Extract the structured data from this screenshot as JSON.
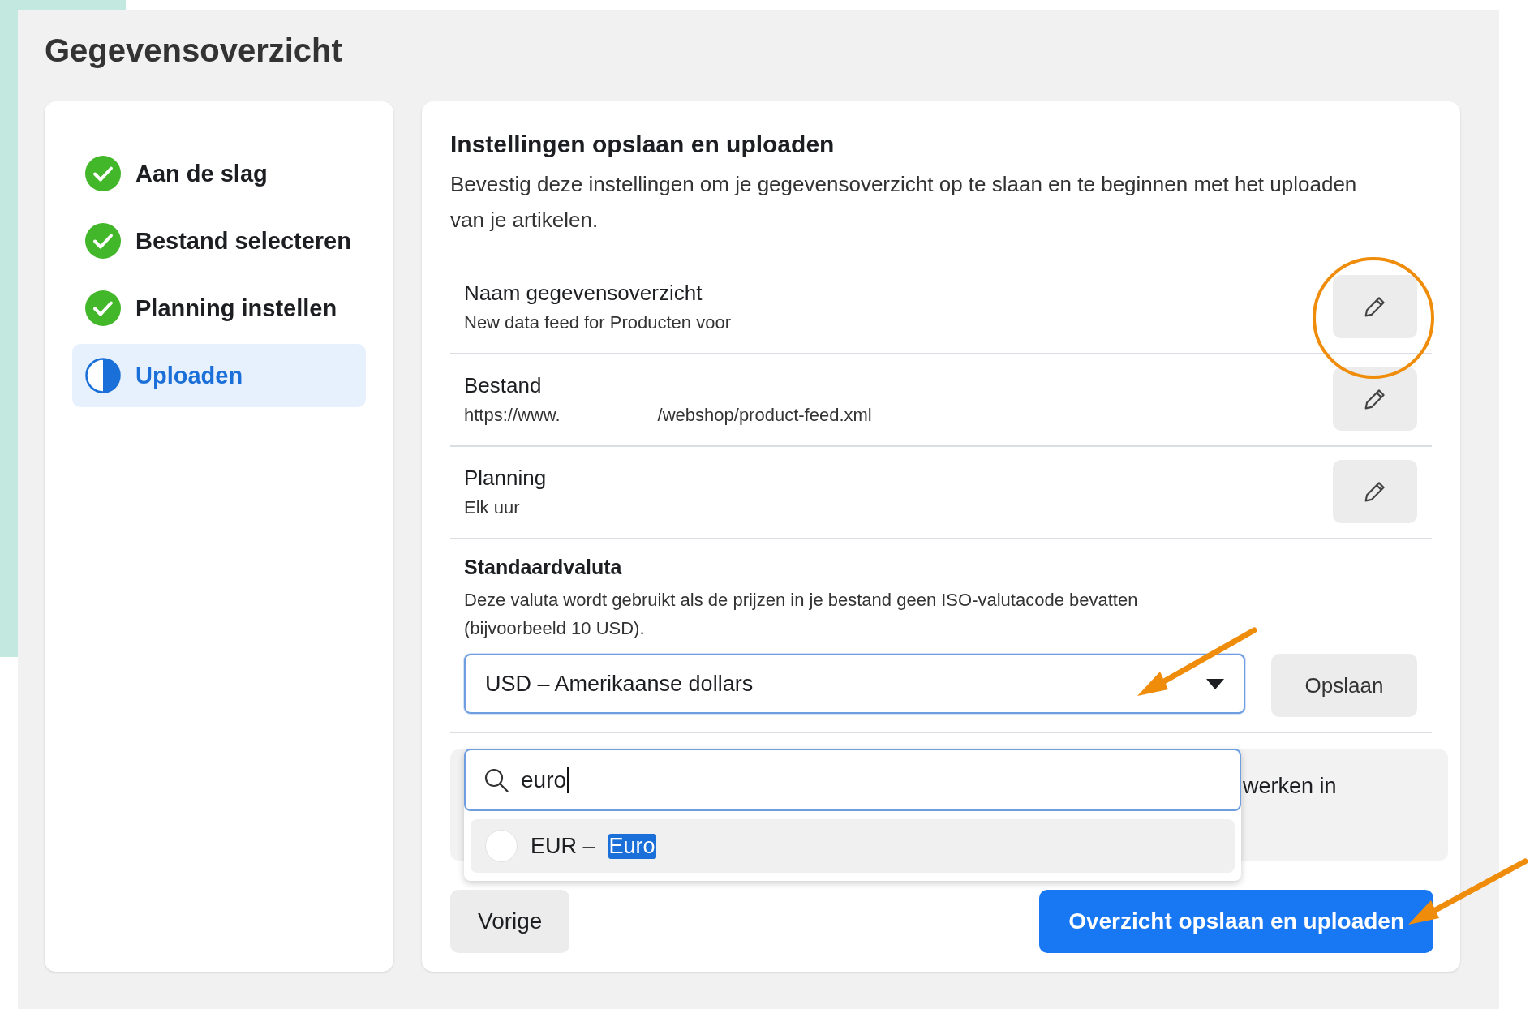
{
  "page": {
    "title": "Gegevensoverzicht"
  },
  "steps": [
    {
      "label": "Aan de slag",
      "kind": "done",
      "selected": false
    },
    {
      "label": "Bestand selecteren",
      "kind": "done",
      "selected": false
    },
    {
      "label": "Planning instellen",
      "kind": "done",
      "selected": false
    },
    {
      "label": "Uploaden",
      "kind": "current",
      "selected": true
    }
  ],
  "panel": {
    "heading": "Instellingen opslaan en uploaden",
    "description": "Bevestig deze instellingen om je gegevensoverzicht op te slaan en te beginnen met het uploaden van je artikelen."
  },
  "settings": [
    {
      "label": "Naam gegevensoverzicht",
      "value_parts": [
        "New data feed for Producten voor"
      ]
    },
    {
      "label": "Bestand",
      "value_parts": [
        "https://www.",
        "/webshop/product-feed.xml"
      ]
    },
    {
      "label": "Planning",
      "value_parts": [
        "Elk uur"
      ]
    }
  ],
  "currency": {
    "label": "Standaardvaluta",
    "description": "Deze valuta wordt gebruikt als de prijzen in je bestand geen ISO-valutacode bevatten (bijvoorbeeld 10 USD).",
    "selected_value": "USD – Amerikaanse dollars",
    "expanded": true,
    "save_button": "Opslaan"
  },
  "dropdown": {
    "search_value": "euro",
    "options": [
      {
        "code": "EUR –",
        "match": "Euro",
        "selected": false
      }
    ]
  },
  "notice_fragment": "werken in",
  "buttons": {
    "back": "Vorige",
    "primary": "Overzicht opslaan en uploaden"
  }
}
